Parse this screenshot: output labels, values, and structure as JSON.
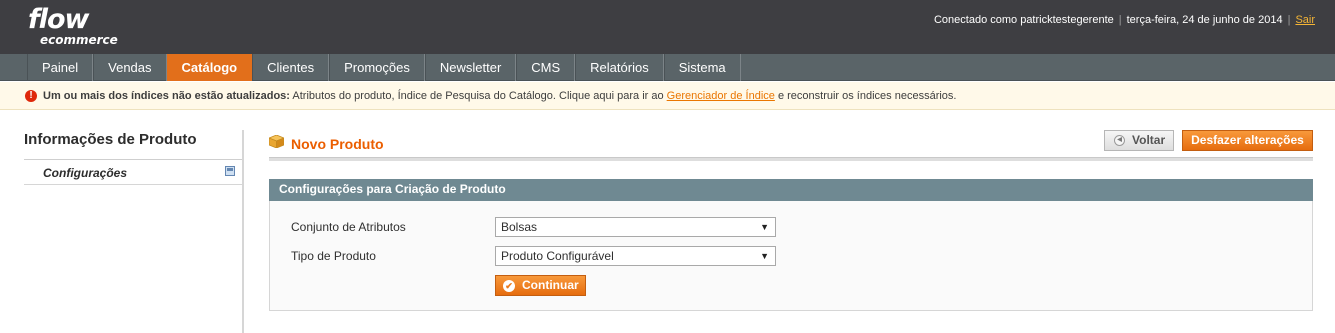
{
  "header": {
    "logo_main": "flow",
    "logo_sub": "ecommerce",
    "connected_as": "Conectado como patricktestegerente",
    "date": "terça-feira, 24 de junho de 2014",
    "logout": "Sair"
  },
  "nav": {
    "items": [
      "Painel",
      "Vendas",
      "Catálogo",
      "Clientes",
      "Promoções",
      "Newsletter",
      "CMS",
      "Relatórios",
      "Sistema"
    ],
    "active": "Catálogo"
  },
  "notice": {
    "icon": "error-icon",
    "bold": "Um ou mais dos índices não estão atualizados:",
    "text_before": " Atributos do produto, Índice de Pesquisa do Catálogo. Clique aqui para ir ao ",
    "link": "Gerenciador de Índice",
    "text_after": " e reconstruir os índices necessários."
  },
  "sidebar": {
    "title": "Informações de Produto",
    "tab_label": "Configurações",
    "tab_icon": "save-icon"
  },
  "page": {
    "title": "Novo Produto",
    "title_icon": "box-icon",
    "back_label": "Voltar",
    "reset_label": "Desfazer alterações"
  },
  "form": {
    "section_title": "Configurações para Criação de Produto",
    "attr_set_label": "Conjunto de Atributos",
    "attr_set_value": "Bolsas",
    "product_type_label": "Tipo de Produto",
    "product_type_value": "Produto Configurável",
    "continue_label": "Continuar"
  },
  "colors": {
    "header_bg": "#3e3e42",
    "nav_bg": "#5a6468",
    "accent": "#e26f1b",
    "title_orange": "#eb5e00",
    "section_head": "#6f8992"
  }
}
